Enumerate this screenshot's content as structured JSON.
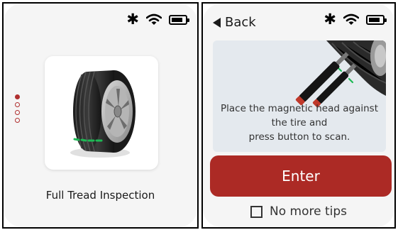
{
  "status_bar": {
    "bluetooth_icon": "bluetooth-icon",
    "wifi_icon": "wifi-icon",
    "battery_icon": "battery-icon",
    "battery_level": 0.85
  },
  "screen1": {
    "page_indicator": {
      "count": 4,
      "active_index": 0
    },
    "mode_card": {
      "icon": "tire-icon",
      "label": "Full Tread Inspection"
    }
  },
  "screen2": {
    "back_label": "Back",
    "tip_illustration": "tread-probe-on-tire-image",
    "tip_lines": [
      "Place the magnetic head against",
      "the tire and",
      "press button to scan."
    ],
    "enter_label": "Enter",
    "no_more_tips_label": "No more tips",
    "no_more_tips_checked": false
  },
  "colors": {
    "accent": "#ac2a25",
    "dot": "#b03030",
    "tip_bg": "#e4e9ee",
    "tread_highlight": "#1db954"
  }
}
